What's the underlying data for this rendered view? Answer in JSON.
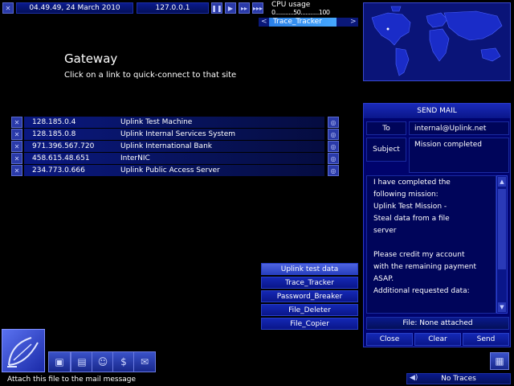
{
  "topbar": {
    "datetime": "04.49.49, 24 March 2010",
    "ip": "127.0.0.1",
    "cpu_label": "CPU usage",
    "cpu_scale_left": "0",
    "cpu_scale_mid": "50",
    "cpu_scale_right": "100",
    "cpu_dots_left": "...........",
    "cpu_dots_right": "...........",
    "tracker_label": "Trace_Tracker",
    "tracker_prev": "<",
    "tracker_next": ">"
  },
  "gateway": {
    "title": "Gateway",
    "subtitle": "Click on a link to quick-connect to that site",
    "links": [
      {
        "ip": "128.185.0.4",
        "name": "Uplink Test Machine"
      },
      {
        "ip": "128.185.0.8",
        "name": "Uplink Internal Services System"
      },
      {
        "ip": "971.396.567.720",
        "name": "Uplink International Bank"
      },
      {
        "ip": "458.615.48.651",
        "name": "InterNIC"
      },
      {
        "ip": "234.773.0.666",
        "name": "Uplink Public Access Server"
      }
    ]
  },
  "files": {
    "items": [
      {
        "label": "Uplink test data",
        "selected": true
      },
      {
        "label": "Trace_Tracker",
        "selected": false
      },
      {
        "label": "Password_Breaker",
        "selected": false
      },
      {
        "label": "File_Deleter",
        "selected": false
      },
      {
        "label": "File_Copier",
        "selected": false
      }
    ]
  },
  "mail": {
    "header": "SEND MAIL",
    "to_label": "To",
    "to_value": "internal@Uplink.net",
    "subject_label": "Subject",
    "subject_value": "Mission completed",
    "body_lines": [
      "I have completed the",
      "following mission:",
      "Uplink Test Mission -",
      "Steal data from a file",
      "server",
      "",
      "Please credit my account",
      "with the remaining payment",
      "ASAP.",
      "Additional requested data:"
    ],
    "file_status": "File: None attached",
    "close_label": "Close",
    "clear_label": "Clear",
    "send_label": "Send"
  },
  "status": {
    "hint": "Attach this file to the mail message",
    "traces": "No Traces"
  },
  "colors": {
    "background": "#000000",
    "panel": "#00036c",
    "button": "#1428b4",
    "selected": "#4e64e0",
    "map_bg": "#0a1478"
  }
}
